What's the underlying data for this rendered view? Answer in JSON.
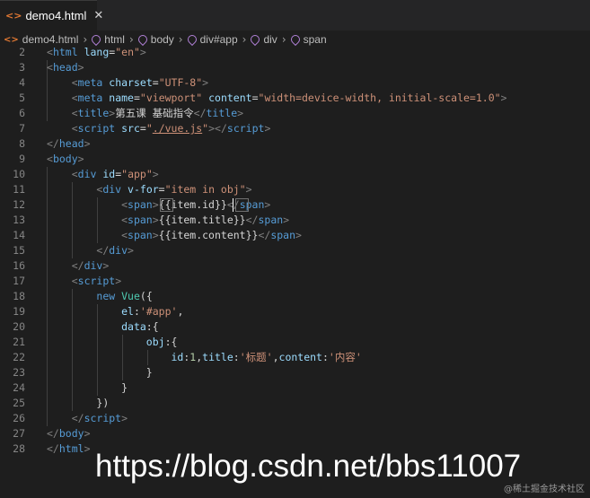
{
  "tab": {
    "icon": "<>",
    "icon_name": "html-file-icon",
    "label": "demo4.html",
    "close": "✕"
  },
  "breadcrumb": {
    "items": [
      {
        "label": "demo4.html",
        "icon": "html-file-icon"
      },
      {
        "label": "html",
        "icon": "element-icon"
      },
      {
        "label": "body",
        "icon": "element-icon"
      },
      {
        "label": "div#app",
        "icon": "element-icon"
      },
      {
        "label": "div",
        "icon": "element-icon"
      },
      {
        "label": "span",
        "icon": "element-icon"
      }
    ]
  },
  "editor": {
    "lines": [
      {
        "n": "2",
        "tokens": [
          [
            "brk",
            "<"
          ],
          [
            "tag",
            "html"
          ],
          [
            "txt",
            " "
          ],
          [
            "attr",
            "lang"
          ],
          [
            "txt",
            "="
          ],
          [
            "str",
            "\"en\""
          ],
          [
            "brk",
            ">"
          ]
        ]
      },
      {
        "n": "3",
        "tokens": [
          [
            "brk",
            "<"
          ],
          [
            "tag",
            "head"
          ],
          [
            "brk",
            ">"
          ]
        ]
      },
      {
        "n": "4",
        "tokens": [
          [
            "txt",
            "    "
          ],
          [
            "brk",
            "<"
          ],
          [
            "tag",
            "meta"
          ],
          [
            "txt",
            " "
          ],
          [
            "attr",
            "charset"
          ],
          [
            "txt",
            "="
          ],
          [
            "str",
            "\"UTF-8\""
          ],
          [
            "brk",
            ">"
          ]
        ]
      },
      {
        "n": "5",
        "tokens": [
          [
            "txt",
            "    "
          ],
          [
            "brk",
            "<"
          ],
          [
            "tag",
            "meta"
          ],
          [
            "txt",
            " "
          ],
          [
            "attr",
            "name"
          ],
          [
            "txt",
            "="
          ],
          [
            "str",
            "\"viewport\""
          ],
          [
            "txt",
            " "
          ],
          [
            "attr",
            "content"
          ],
          [
            "txt",
            "="
          ],
          [
            "str",
            "\"width=device-width, initial-scale=1.0\""
          ],
          [
            "brk",
            ">"
          ]
        ]
      },
      {
        "n": "6",
        "tokens": [
          [
            "txt",
            "    "
          ],
          [
            "brk",
            "<"
          ],
          [
            "tag",
            "title"
          ],
          [
            "brk",
            ">"
          ],
          [
            "txt",
            "第五课 基础指令"
          ],
          [
            "brk",
            "</"
          ],
          [
            "tag",
            "title"
          ],
          [
            "brk",
            ">"
          ]
        ]
      },
      {
        "n": "7",
        "tokens": [
          [
            "txt",
            "    "
          ],
          [
            "brk",
            "<"
          ],
          [
            "tag",
            "script"
          ],
          [
            "txt",
            " "
          ],
          [
            "attr",
            "src"
          ],
          [
            "txt",
            "="
          ],
          [
            "str",
            "\""
          ],
          [
            "link",
            "./vue.js"
          ],
          [
            "str",
            "\""
          ],
          [
            "brk",
            "></"
          ],
          [
            "tag",
            "script"
          ],
          [
            "brk",
            ">"
          ]
        ]
      },
      {
        "n": "8",
        "tokens": [
          [
            "brk",
            "</"
          ],
          [
            "tag",
            "head"
          ],
          [
            "brk",
            ">"
          ]
        ]
      },
      {
        "n": "9",
        "tokens": [
          [
            "brk",
            "<"
          ],
          [
            "tag",
            "body"
          ],
          [
            "brk",
            ">"
          ]
        ]
      },
      {
        "n": "10",
        "tokens": [
          [
            "txt",
            "    "
          ],
          [
            "brk",
            "<"
          ],
          [
            "tag",
            "div"
          ],
          [
            "txt",
            " "
          ],
          [
            "attr",
            "id"
          ],
          [
            "txt",
            "="
          ],
          [
            "str",
            "\"app\""
          ],
          [
            "brk",
            ">"
          ]
        ]
      },
      {
        "n": "11",
        "tokens": [
          [
            "txt",
            "        "
          ],
          [
            "brk",
            "<"
          ],
          [
            "tag",
            "div"
          ],
          [
            "txt",
            " "
          ],
          [
            "attr",
            "v-for"
          ],
          [
            "txt",
            "="
          ],
          [
            "str",
            "\"item in obj\""
          ],
          [
            "brk",
            ">"
          ]
        ]
      },
      {
        "n": "12",
        "tokens": [
          [
            "txt",
            "            "
          ],
          [
            "brk",
            "<"
          ],
          [
            "tag",
            "span"
          ],
          [
            "brk",
            ">"
          ],
          [
            "txt",
            "{{item.id}}"
          ],
          [
            "brk",
            "</"
          ],
          [
            "tag",
            "span"
          ],
          [
            "brk",
            ">"
          ]
        ]
      },
      {
        "n": "13",
        "tokens": [
          [
            "txt",
            "            "
          ],
          [
            "brk",
            "<"
          ],
          [
            "tag",
            "span"
          ],
          [
            "brk",
            ">"
          ],
          [
            "txt",
            "{{item.title}}"
          ],
          [
            "brk",
            "</"
          ],
          [
            "tag",
            "span"
          ],
          [
            "brk",
            ">"
          ]
        ]
      },
      {
        "n": "14",
        "tokens": [
          [
            "txt",
            "            "
          ],
          [
            "brk",
            "<"
          ],
          [
            "tag",
            "span"
          ],
          [
            "brk",
            ">"
          ],
          [
            "txt",
            "{{item.content}}"
          ],
          [
            "brk",
            "</"
          ],
          [
            "tag",
            "span"
          ],
          [
            "brk",
            ">"
          ]
        ]
      },
      {
        "n": "15",
        "tokens": [
          [
            "txt",
            "        "
          ],
          [
            "brk",
            "</"
          ],
          [
            "tag",
            "div"
          ],
          [
            "brk",
            ">"
          ]
        ]
      },
      {
        "n": "16",
        "tokens": [
          [
            "txt",
            "    "
          ],
          [
            "brk",
            "</"
          ],
          [
            "tag",
            "div"
          ],
          [
            "brk",
            ">"
          ]
        ]
      },
      {
        "n": "17",
        "tokens": [
          [
            "txt",
            "    "
          ],
          [
            "brk",
            "<"
          ],
          [
            "tag",
            "script"
          ],
          [
            "brk",
            ">"
          ]
        ]
      },
      {
        "n": "18",
        "tokens": [
          [
            "txt",
            "        "
          ],
          [
            "kw",
            "new"
          ],
          [
            "txt",
            " "
          ],
          [
            "cls",
            "Vue"
          ],
          [
            "txt",
            "({"
          ]
        ]
      },
      {
        "n": "19",
        "tokens": [
          [
            "txt",
            "            "
          ],
          [
            "key",
            "el"
          ],
          [
            "txt",
            ":"
          ],
          [
            "str",
            "'#app'"
          ],
          [
            "txt",
            ","
          ]
        ]
      },
      {
        "n": "20",
        "tokens": [
          [
            "txt",
            "            "
          ],
          [
            "key",
            "data"
          ],
          [
            "txt",
            ":{"
          ]
        ]
      },
      {
        "n": "21",
        "tokens": [
          [
            "txt",
            "                "
          ],
          [
            "key",
            "obj"
          ],
          [
            "txt",
            ":{"
          ]
        ]
      },
      {
        "n": "22",
        "tokens": [
          [
            "txt",
            "                    "
          ],
          [
            "key",
            "id"
          ],
          [
            "txt",
            ":"
          ],
          [
            "num",
            "1"
          ],
          [
            "txt",
            ","
          ],
          [
            "key",
            "title"
          ],
          [
            "txt",
            ":"
          ],
          [
            "str",
            "'标题'"
          ],
          [
            "txt",
            ","
          ],
          [
            "key",
            "content"
          ],
          [
            "txt",
            ":"
          ],
          [
            "str",
            "'内容'"
          ]
        ]
      },
      {
        "n": "23",
        "tokens": [
          [
            "txt",
            "                "
          ],
          [
            "txt",
            "}"
          ]
        ]
      },
      {
        "n": "24",
        "tokens": [
          [
            "txt",
            "            "
          ],
          [
            "txt",
            "}"
          ]
        ]
      },
      {
        "n": "25",
        "tokens": [
          [
            "txt",
            "        "
          ],
          [
            "txt",
            "})"
          ]
        ]
      },
      {
        "n": "26",
        "tokens": [
          [
            "txt",
            "    "
          ],
          [
            "brk",
            "</"
          ],
          [
            "tag",
            "script"
          ],
          [
            "brk",
            ">"
          ]
        ]
      },
      {
        "n": "27",
        "tokens": [
          [
            "brk",
            "</"
          ],
          [
            "tag",
            "body"
          ],
          [
            "brk",
            ">"
          ]
        ]
      },
      {
        "n": "28",
        "tokens": [
          [
            "brk",
            "</"
          ],
          [
            "tag",
            "html"
          ],
          [
            "brk",
            ">"
          ]
        ]
      }
    ]
  },
  "watermark": {
    "url": "https://blog.csdn.net/bbs11007",
    "small": "@稀土掘金技术社区"
  },
  "colors": {
    "background": "#1e1e1e",
    "tag": "#569cd6",
    "attribute": "#9cdcfe",
    "string": "#ce9178",
    "html_icon": "#e37933",
    "element_icon": "#b180d7"
  }
}
